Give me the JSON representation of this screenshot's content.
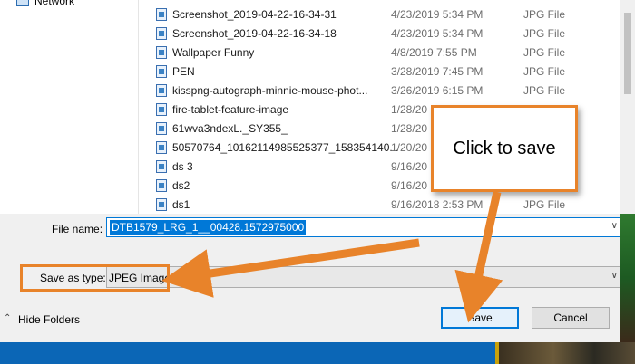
{
  "nav": {
    "network_label": "Network"
  },
  "files": [
    {
      "name": "Screenshot_2019-04-22-16-34-31",
      "date": "4/23/2019 5:34 PM",
      "type": "JPG File"
    },
    {
      "name": "Screenshot_2019-04-22-16-34-18",
      "date": "4/23/2019 5:34 PM",
      "type": "JPG File"
    },
    {
      "name": "Wallpaper Funny",
      "date": "4/8/2019 7:55 PM",
      "type": "JPG File"
    },
    {
      "name": "PEN",
      "date": "3/28/2019 7:45 PM",
      "type": "JPG File"
    },
    {
      "name": "kisspng-autograph-minnie-mouse-phot...",
      "date": "3/26/2019 6:15 PM",
      "type": "JPG File"
    },
    {
      "name": "fire-tablet-feature-image",
      "date": "1/28/20",
      "type": ""
    },
    {
      "name": "61wva3ndexL._SY355_",
      "date": "1/28/20",
      "type": ""
    },
    {
      "name": "50570764_10162114985525377_158354140...",
      "date": "1/20/20",
      "type": ""
    },
    {
      "name": "ds 3",
      "date": "9/16/20",
      "type": ""
    },
    {
      "name": "ds2",
      "date": "9/16/20",
      "type": ""
    },
    {
      "name": "ds1",
      "date": "9/16/2018 2:53 PM",
      "type": "JPG File"
    }
  ],
  "form": {
    "file_name_label": "File name:",
    "file_name_value": "DTB1579_LRG_1__00428.1572975000",
    "save_as_type_label": "Save as type:",
    "save_as_type_value": "JPEG Image"
  },
  "footer": {
    "hide_folders_label": "Hide Folders",
    "save_label": "Save",
    "cancel_label": "Cancel"
  },
  "annotation": {
    "callout_text": "Click to save",
    "accent_color": "#e8832a"
  }
}
